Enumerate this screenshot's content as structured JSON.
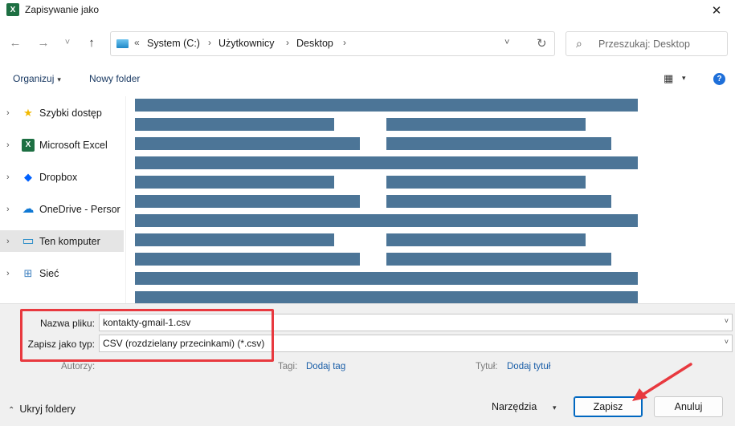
{
  "window": {
    "title": "Zapisywanie jako",
    "app_icon_letter": "X",
    "close_glyph": "✕"
  },
  "nav": {
    "back_glyph": "←",
    "forward_glyph": "→",
    "recent_glyph": "˅",
    "up_glyph": "↑",
    "path_prefix": "«",
    "crumbs": [
      "System (C:)",
      "Użytkownicy",
      "Desktop"
    ],
    "crumb_sep": "›",
    "dropdown_glyph": "˅",
    "refresh_glyph": "↻",
    "search_placeholder": "Przeszukaj: Desktop",
    "search_glyph": "⌕"
  },
  "toolbar": {
    "organize": "Organizuj",
    "new_folder": "Nowy folder",
    "caret": "▾",
    "view_glyph": "▦",
    "help_glyph": "?"
  },
  "sidebar": {
    "chevron": "›",
    "items": [
      {
        "label": "Szybki dostęp",
        "icon": "star-icon",
        "glyph": "★",
        "color": "#f2b900"
      },
      {
        "label": "Microsoft Excel",
        "icon": "excel-icon",
        "glyph": "X",
        "color": "#1d6f42"
      },
      {
        "label": "Dropbox",
        "icon": "dropbox-icon",
        "glyph": "◆",
        "color": "#0061fe"
      },
      {
        "label": "OneDrive - Persor",
        "icon": "onedrive-icon",
        "glyph": "☁",
        "color": "#0f78d4"
      },
      {
        "label": "Ten komputer",
        "icon": "computer-icon",
        "glyph": "▭",
        "color": "#1e88c7"
      },
      {
        "label": "Sieć",
        "icon": "network-icon",
        "glyph": "⊞",
        "color": "#3d7fbf"
      }
    ]
  },
  "form": {
    "filename_label": "Nazwa pliku:",
    "filename_value": "kontakty-gmail-1.csv",
    "filetype_label": "Zapisz jako typ:",
    "filetype_value": "CSV (rozdzielany przecinkami) (*.csv)",
    "dropdown_glyph": "˅",
    "authors_label": "Autorzy:",
    "tags_label": "Tagi:",
    "tags_link": "Dodaj tag",
    "title_label": "Tytuł:",
    "title_link": "Dodaj tytuł"
  },
  "footer": {
    "hide_folders": "Ukryj foldery",
    "hide_chevron": "⌃",
    "tools": "Narzędzia",
    "tools_caret": "▾",
    "save": "Zapisz",
    "cancel": "Anuluj"
  },
  "colors": {
    "redacted_bar": "#4c7597",
    "annotation_red": "#e8393f",
    "primary_border": "#0067c0",
    "link": "#1a5ea8"
  }
}
